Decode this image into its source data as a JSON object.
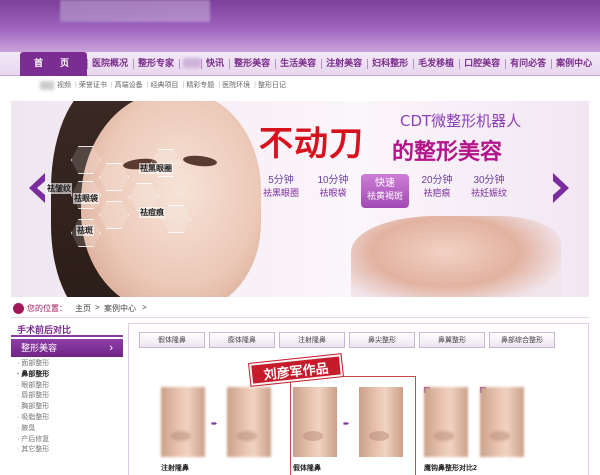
{
  "nav": {
    "home": "首　页",
    "items": [
      "医院概况",
      "整形专家",
      "",
      "快讯",
      "整形美容",
      "生活美容",
      "注射美容",
      "妇科整形",
      "毛发移植",
      "口腔美容",
      "有问必答",
      "案例中心"
    ]
  },
  "subnav": [
    "视频",
    "荣誉证书",
    "高端设备",
    "经典项目",
    "精彩专题",
    "医院环境",
    "整形日记"
  ],
  "banner": {
    "headline_big": "不动刀",
    "headline_small": "的整形美容",
    "brand": "CDT微整形机器人",
    "face_labels": [
      "祛黑眼圈",
      "祛皱纹",
      "祛眼袋",
      "祛痘痕",
      "祛斑"
    ],
    "features": [
      {
        "time": "5分钟",
        "desc": "祛黑眼圈"
      },
      {
        "time": "10分钟",
        "desc": "祛眼袋"
      },
      {
        "time": "快速",
        "desc": "祛黄褐斑"
      },
      {
        "time": "20分钟",
        "desc": "祛疤痕"
      },
      {
        "time": "30分钟",
        "desc": "祛妊娠纹"
      }
    ]
  },
  "breadcrumb": {
    "prefix": "您的位置：",
    "home": "主页",
    "sep": ">",
    "current": "案例中心",
    "tail": ">"
  },
  "sidebar": {
    "title": "手术前后对比",
    "category": "整形美容",
    "items": [
      "面部整形",
      "鼻部整形",
      "眼部整形",
      "唇部整形",
      "胸部整形",
      "吸脂整形",
      "腋臭",
      "产后修复",
      "其它整形"
    ],
    "active_index": 1
  },
  "tabs": [
    "假体隆鼻",
    "膨体隆鼻",
    "注射隆鼻",
    "鼻尖整形",
    "鼻翼整形",
    "鼻部综合整形"
  ],
  "cases": [
    {
      "caption": "注射隆鼻"
    },
    {
      "caption": "假体隆鼻"
    },
    {
      "caption": "鹰钩鼻整形对比2"
    }
  ],
  "stamp": "刘彦军作品",
  "colors": {
    "brand_purple": "#7b2e92",
    "accent_red": "#d8121d",
    "magenta": "#b2148a"
  }
}
